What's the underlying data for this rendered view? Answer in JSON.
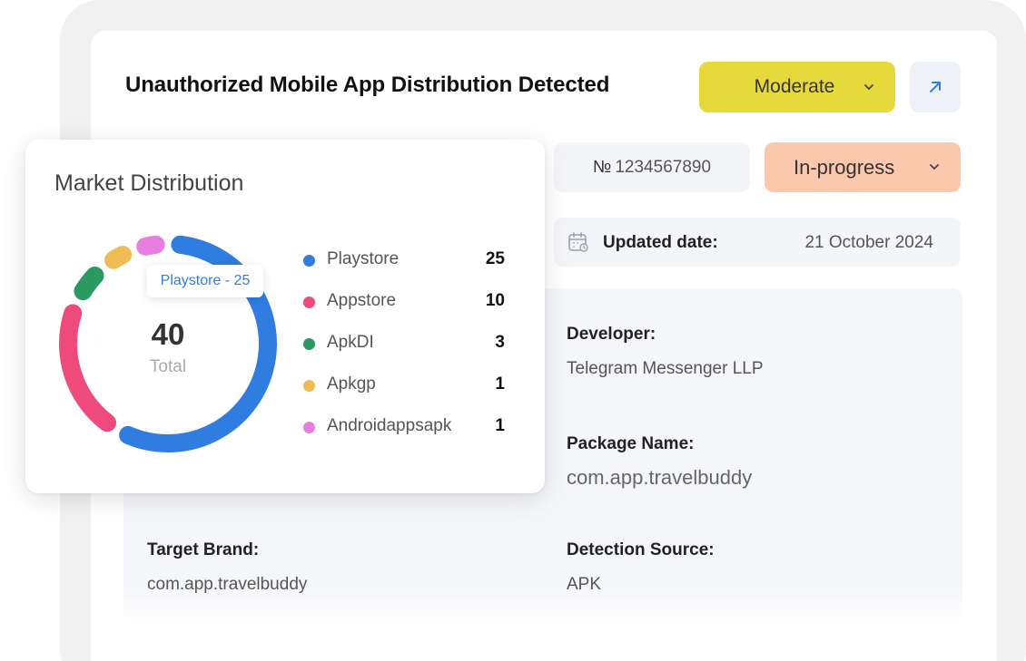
{
  "header": {
    "title": "Unauthorized Mobile App Distribution Detected",
    "severity_label": "Moderate",
    "severity_color": "#e6d93c",
    "open_icon": "arrow-up-right-icon"
  },
  "meta": {
    "number_prefix": "№",
    "number": "1234567890",
    "status_label": "In-progress",
    "status_color": "#fbc8ae",
    "updated_label": "Updated date:",
    "updated_value": "21 October 2024",
    "calendar_icon": "calendar-icon"
  },
  "details": {
    "developer_label": "Developer:",
    "developer_value": "Telegram Messenger LLP",
    "package_label": "Package Name:",
    "package_value": "com.app.travelbuddy",
    "brand_label": "Target Brand:",
    "brand_value": "com.app.travelbuddy",
    "source_label": "Detection Source:",
    "source_value": "APK"
  },
  "market": {
    "title": "Market Distribution",
    "total_value": "40",
    "total_label": "Total",
    "tooltip": "Playstore - 25"
  },
  "chart_data": {
    "type": "pie",
    "title": "Market Distribution",
    "categories": [
      "Playstore",
      "Appstore",
      "ApkDI",
      "Apkgp",
      "Androidappsapk"
    ],
    "values": [
      25,
      10,
      3,
      1,
      1
    ],
    "colors": [
      "#2f7de1",
      "#ee4a7b",
      "#2a9a60",
      "#f0bb55",
      "#e77ee0"
    ],
    "total": 40,
    "legend_position": "right"
  }
}
